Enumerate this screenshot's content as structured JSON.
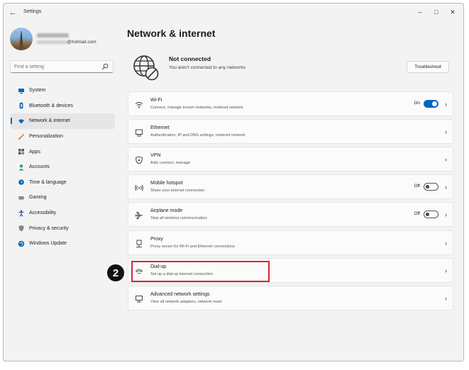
{
  "window": {
    "title": "Settings",
    "controls": {
      "minimize": "–",
      "maximize": "□",
      "close": "✕"
    }
  },
  "user": {
    "email": "@hotmail.com"
  },
  "search": {
    "placeholder": "Find a setting"
  },
  "sidebar": {
    "items": [
      {
        "label": "System",
        "icon": "monitor-icon",
        "color": "#0067c0"
      },
      {
        "label": "Bluetooth & devices",
        "icon": "bluetooth-icon",
        "color": "#0067c0"
      },
      {
        "label": "Network & internet",
        "icon": "wifi-icon",
        "color": "#0067c0",
        "selected": true
      },
      {
        "label": "Personalization",
        "icon": "brush-icon",
        "color": "#e3833b"
      },
      {
        "label": "Apps",
        "icon": "apps-icon",
        "color": "#555555"
      },
      {
        "label": "Accounts",
        "icon": "person-icon",
        "color": "#2aa06b"
      },
      {
        "label": "Time & language",
        "icon": "globe-clock-icon",
        "color": "#0067c0"
      },
      {
        "label": "Gaming",
        "icon": "gamepad-icon",
        "color": "#777777"
      },
      {
        "label": "Accessibility",
        "icon": "accessibility-icon",
        "color": "#1b4f9c"
      },
      {
        "label": "Privacy & security",
        "icon": "shield-icon",
        "color": "#777777"
      },
      {
        "label": "Windows Update",
        "icon": "update-icon",
        "color": "#0067c0"
      }
    ]
  },
  "main": {
    "title": "Network & internet",
    "status": {
      "title": "Not connected",
      "description": "You aren't connected to any networks",
      "troubleshoot_label": "Troubleshoot"
    },
    "cards": [
      {
        "title": "Wi-Fi",
        "desc": "Connect, manage known networks, metered network",
        "icon": "wifi-icon",
        "toggle": "On"
      },
      {
        "title": "Ethernet",
        "desc": "Authentication, IP and DNS settings, metered network",
        "icon": "ethernet-icon"
      },
      {
        "title": "VPN",
        "desc": "Add, connect, manage",
        "icon": "vpn-shield-icon"
      },
      {
        "title": "Mobile hotspot",
        "desc": "Share your internet connection",
        "icon": "hotspot-icon",
        "toggle": "Off"
      },
      {
        "title": "Airplane mode",
        "desc": "Stop all wireless communication",
        "icon": "airplane-icon",
        "toggle": "Off"
      },
      {
        "title": "Proxy",
        "desc": "Proxy server for Wi-Fi and Ethernet connections",
        "icon": "proxy-icon"
      },
      {
        "title": "Dial-up",
        "desc": "Set up a dial-up internet connection",
        "icon": "dialup-icon"
      },
      {
        "title": "Advanced network settings",
        "desc": "View all network adapters, network reset",
        "icon": "advanced-network-icon"
      }
    ]
  },
  "annotation": {
    "step_number": "2",
    "highlight_color": "#d7262f"
  },
  "accent_color": "#0067c0"
}
